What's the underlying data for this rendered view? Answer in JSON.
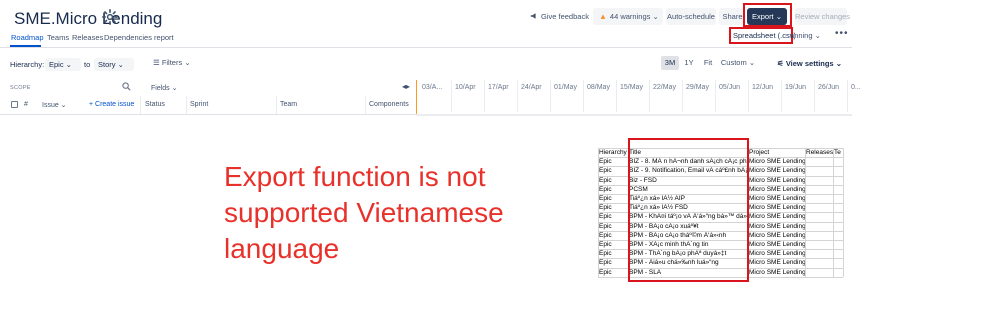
{
  "header": {
    "title": "SME.Micro Lending",
    "feedback_label": "Give feedback",
    "warnings_label": "44 warnings",
    "autoschedule_label": "Auto-schedule",
    "share_label": "Share",
    "export_label": "Export",
    "review_label": "Review changes"
  },
  "tabs": [
    "Roadmap",
    "Teams",
    "Releases",
    "Dependencies report"
  ],
  "export_menu": {
    "csv_label": "Spreadsheet (.csv)",
    "planning_label": "anning"
  },
  "filters": {
    "hierarchy_label": "Hierarchy:",
    "from_value": "Epic",
    "to_label": "to",
    "to_value": "Story",
    "filters_label": "Filters",
    "zoom_options": [
      "3M",
      "1Y",
      "Fit",
      "Custom"
    ],
    "zoom_selected": "3M",
    "view_settings_label": "View settings"
  },
  "grid": {
    "scope_label": "SCOPE",
    "fields_label": "Fields",
    "hash_label": "#",
    "issue_label": "Issue",
    "create_issue_label": "+ Create issue",
    "columns": [
      "Status",
      "Sprint",
      "Team",
      "Components"
    ],
    "months": [
      "03/A...",
      "10/Apr",
      "17/Apr",
      "24/Apr",
      "01/May",
      "08/May",
      "15/May",
      "22/May",
      "29/May",
      "05/Jun",
      "12/Jun",
      "19/Jun",
      "26/Jun",
      "0..."
    ]
  },
  "annotation": {
    "lines": [
      "Export function is not",
      "supported Vietnamese",
      "language"
    ]
  },
  "spreadsheet": {
    "headers": [
      "Hierarchy",
      "Title",
      "Project",
      "Releases",
      "Te"
    ],
    "rows": [
      [
        "Epic",
        "BIZ - 8. MÃ n hÃ¬nh danh sÃ¡ch cÃ¡c phÆ°",
        "Micro SME Lending",
        "",
        ""
      ],
      [
        "Epic",
        "BIZ - 9. Notification, Email vÃ  cáº£nh bÃ¡",
        "Micro SME Lending",
        "",
        ""
      ],
      [
        "Epic",
        "Biz - FSD",
        "Micro SME Lending",
        "",
        ""
      ],
      [
        "Epic",
        "PCSM",
        "Micro SME Lending",
        "",
        ""
      ],
      [
        "Epic",
        "Tiáº¿n xá»­ lÃ½ AIP",
        "Micro SME Lending",
        "",
        ""
      ],
      [
        "Epic",
        "Tiáº¿n xá»­ lÃ½ FSD",
        "Micro SME Lending",
        "",
        ""
      ],
      [
        "Epic",
        "BPM - KhÃ¤i táº¡o vÃ  Ä‘á»“ng bá»™ dá»",
        "Micro SME Lending",
        "",
        ""
      ],
      [
        "Epic",
        "BPM - BÃ¡o cÃ¡o xuáº¥t",
        "Micro SME Lending",
        "",
        ""
      ],
      [
        "Epic",
        "BPM - BÃ¡o cÃ¡o tháº©m Ä‘á»‹nh",
        "Micro SME Lending",
        "",
        ""
      ],
      [
        "Epic",
        "BPM - XÃ¡c minh thÃ´ng tin",
        "Micro SME Lending",
        "",
        ""
      ],
      [
        "Epic",
        "BPM - ThÃ´ng bÃ¡o phÃª duyá»‡t",
        "Micro SME Lending",
        "",
        ""
      ],
      [
        "Epic",
        "BPM - Äiá»u chá»‰nh luá»“ng",
        "Micro SME Lending",
        "",
        ""
      ],
      [
        "Epic",
        "BPM - SLA",
        "Micro SME Lending",
        "",
        ""
      ]
    ]
  },
  "colors": {
    "accent": "#0052cc",
    "export_bg": "#253858",
    "highlight_red": "#d9141c",
    "annotation_red": "#e8312a",
    "timeline_today": "#ff991f"
  }
}
